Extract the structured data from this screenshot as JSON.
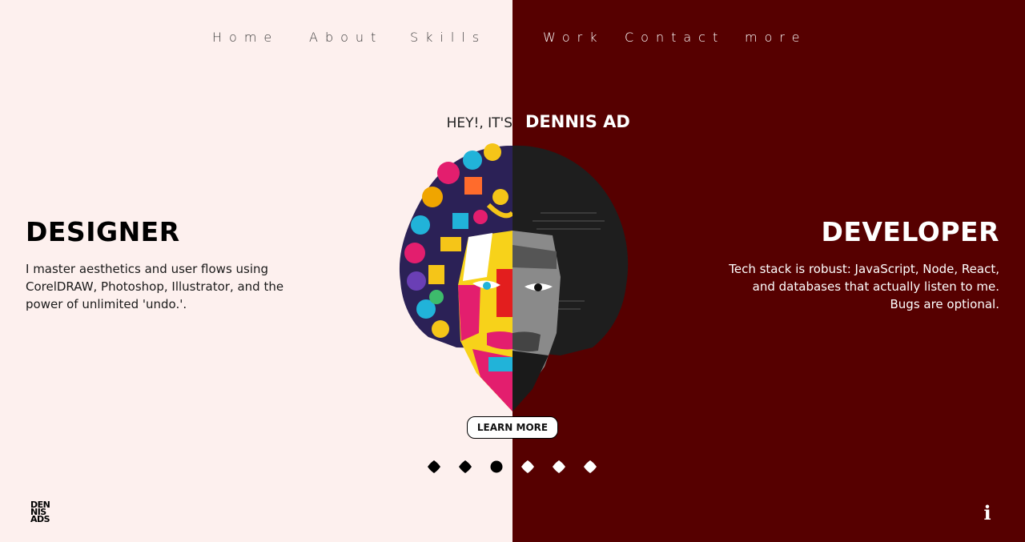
{
  "nav": {
    "items": [
      {
        "label": "Home"
      },
      {
        "label": "About"
      },
      {
        "label": "Skills"
      },
      {
        "label": "Work"
      },
      {
        "label": "Contact"
      },
      {
        "label": "more"
      }
    ]
  },
  "hero": {
    "greeting": "HEY!, IT'S",
    "name": "DENNIS AD",
    "left_title": "DESIGNER",
    "left_text": "I master aesthetics and user flows using CorelDRAW, Photoshop, Illustrator, and the power of unlimited 'undo.'.",
    "right_title": "DEVELOPER",
    "right_text": "Tech stack is robust: JavaScript, Node, React, and databases that actually listen to me. Bugs are optional.",
    "cta_label": "LEARN MORE"
  },
  "logo": {
    "text": "DEN NIS ADS"
  },
  "info_icon_label": "i",
  "colors": {
    "left_bg": "#fdf0ee",
    "right_bg": "#560000",
    "accent_dark": "#000000"
  },
  "carousel": {
    "count": 6,
    "active_index": 2
  }
}
